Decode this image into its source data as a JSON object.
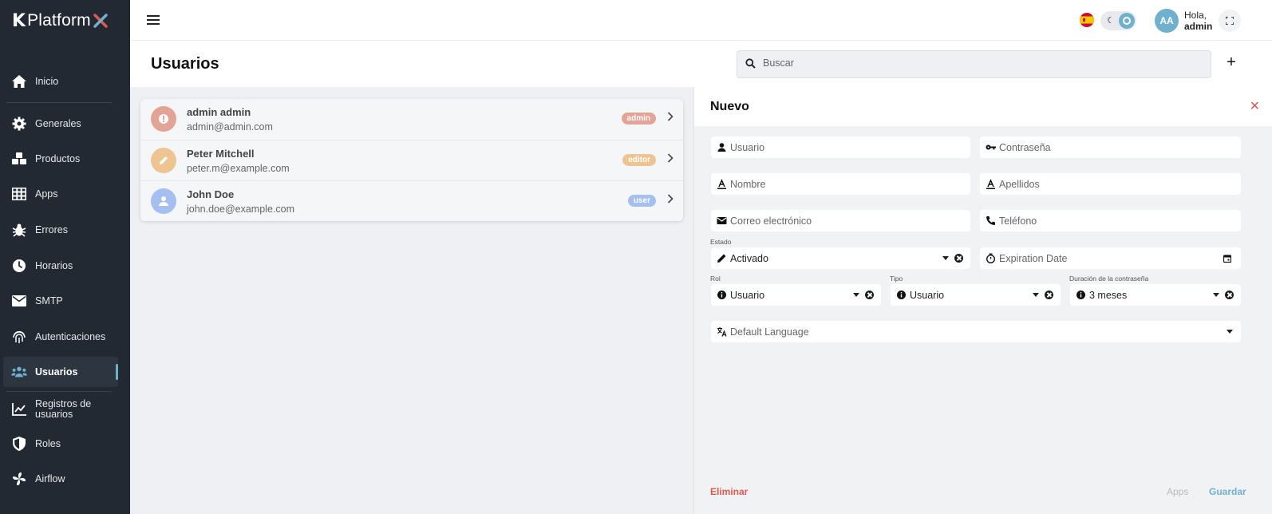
{
  "app": {
    "logo_k": "K",
    "logo_text": "Platform"
  },
  "sidebar": {
    "items": [
      {
        "label": "Inicio",
        "icon": "home-icon"
      },
      {
        "label": "Generales",
        "icon": "gear-icon"
      },
      {
        "label": "Productos",
        "icon": "cubes-icon"
      },
      {
        "label": "Apps",
        "icon": "grid-icon"
      },
      {
        "label": "Errores",
        "icon": "bug-icon"
      },
      {
        "label": "Horarios",
        "icon": "clock-icon"
      },
      {
        "label": "SMTP",
        "icon": "envelope-icon"
      },
      {
        "label": "Autenticaciones",
        "icon": "fingerprint-icon"
      },
      {
        "label": "Usuarios",
        "icon": "users-icon",
        "active": true
      },
      {
        "label": "Registros de usuarios",
        "icon": "chart-line-icon"
      },
      {
        "label": "Roles",
        "icon": "shield-icon"
      },
      {
        "label": "Airflow",
        "icon": "fan-icon"
      }
    ]
  },
  "topbar": {
    "avatar_initials": "AA",
    "greeting": "Hola,",
    "username": "admin"
  },
  "header": {
    "title": "Usuarios",
    "search_placeholder": "Buscar",
    "add_label": "+"
  },
  "users": [
    {
      "name": "admin admin",
      "email": "admin@admin.com",
      "role": "admin",
      "color": "#e4a397"
    },
    {
      "name": "Peter Mitchell",
      "email": "peter.m@example.com",
      "role": "editor",
      "color": "#eec592"
    },
    {
      "name": "John Doe",
      "email": "john.doe@example.com",
      "role": "user",
      "color": "#a5bff0"
    }
  ],
  "panel": {
    "title": "Nuevo",
    "close": "✕",
    "fields": {
      "usuario": "Usuario",
      "contrasena": "Contraseña",
      "nombre": "Nombre",
      "apellidos": "Apellidos",
      "correo": "Correo electrónico",
      "telefono": "Teléfono",
      "estado_label": "Estado",
      "estado_value": "Activado",
      "expiration": "Expiration Date",
      "rol_label": "Rol",
      "rol_value": "Usuario",
      "tipo_label": "Tipo",
      "tipo_value": "Usuario",
      "duracion_label": "Duración de la contraseña",
      "duracion_value": "3 meses",
      "language": "Default Language"
    },
    "actions": {
      "delete": "Eliminar",
      "apps": "Apps",
      "save": "Guardar"
    }
  },
  "colors": {
    "accent": "#6fb1cc",
    "danger": "#e05a4f",
    "sidebar": "#222932"
  }
}
